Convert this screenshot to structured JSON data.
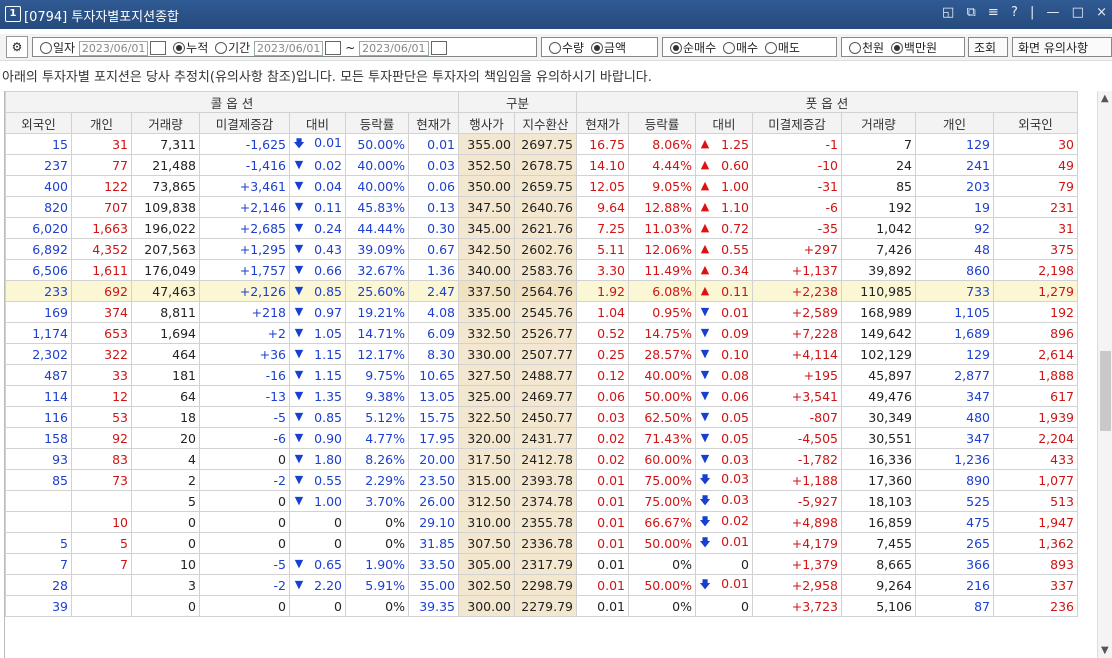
{
  "window": {
    "number": "1",
    "title": "[0794] 투자자별포지션종합",
    "controls": [
      "◱",
      "⧉",
      "≡",
      "?",
      "|",
      "—",
      "□",
      "×"
    ]
  },
  "toolbar": {
    "gear_icon": "gear-icon",
    "date_mode": [
      {
        "label": "일자",
        "selected": false
      },
      {
        "label": "누적",
        "selected": true
      },
      {
        "label": "기간",
        "selected": false
      }
    ],
    "date1": "2023/06/01",
    "date2": "2023/06/01",
    "tilde": "~",
    "date3": "2023/06/01",
    "qty_amount": [
      {
        "label": "수량",
        "selected": false
      },
      {
        "label": "금액",
        "selected": true
      }
    ],
    "buy_sell": [
      {
        "label": "순매수",
        "selected": true
      },
      {
        "label": "매수",
        "selected": false
      },
      {
        "label": "매도",
        "selected": false
      }
    ],
    "unit": [
      {
        "label": "천원",
        "selected": false
      },
      {
        "label": "백만원",
        "selected": true
      }
    ],
    "query_button": "조회",
    "notes_button": "화면 유의사항"
  },
  "notice": "아래의 투자자별 포지션은 당사 추정치(유의사항 참조)입니다. 모든 투자판단은 투자자의 책임임을 유의하시기 바랍니다.",
  "table": {
    "group_headers": {
      "call": "콜 옵 션",
      "mid": "구분",
      "put": "풋 옵 션"
    },
    "columns": [
      "외국인",
      "개인",
      "거래량",
      "미결제증감",
      "대비",
      "등락률",
      "현재가",
      "행사가",
      "지수환산",
      "현재가",
      "등락률",
      "대비",
      "미결제증감",
      "거래량",
      "개인",
      "외국인"
    ],
    "rows": [
      {
        "c_frn": "15",
        "c_ind": "31",
        "c_vol": "7,311",
        "c_oi": "-1,625",
        "c_dir": "down2",
        "c_chg": "0.01",
        "c_rate": "50.00%",
        "c_price": "0.01",
        "strike": "355.00",
        "idx": "2697.75",
        "p_price": "16.75",
        "p_rate": "8.06%",
        "p_dir": "up",
        "p_chg": "1.25",
        "p_oi": "-1",
        "p_vol": "7",
        "p_ind": "129",
        "p_frn": "30"
      },
      {
        "c_frn": "237",
        "c_ind": "77",
        "c_vol": "21,488",
        "c_oi": "-1,416",
        "c_dir": "down",
        "c_chg": "0.02",
        "c_rate": "40.00%",
        "c_price": "0.03",
        "strike": "352.50",
        "idx": "2678.75",
        "p_price": "14.10",
        "p_rate": "4.44%",
        "p_dir": "up",
        "p_chg": "0.60",
        "p_oi": "-10",
        "p_vol": "24",
        "p_ind": "241",
        "p_frn": "49"
      },
      {
        "c_frn": "400",
        "c_ind": "122",
        "c_vol": "73,865",
        "c_oi": "+3,461",
        "c_dir": "down",
        "c_chg": "0.04",
        "c_rate": "40.00%",
        "c_price": "0.06",
        "strike": "350.00",
        "idx": "2659.75",
        "p_price": "12.05",
        "p_rate": "9.05%",
        "p_dir": "up",
        "p_chg": "1.00",
        "p_oi": "-31",
        "p_vol": "85",
        "p_ind": "203",
        "p_frn": "79"
      },
      {
        "c_frn": "820",
        "c_ind": "707",
        "c_vol": "109,838",
        "c_oi": "+2,146",
        "c_dir": "down",
        "c_chg": "0.11",
        "c_rate": "45.83%",
        "c_price": "0.13",
        "strike": "347.50",
        "idx": "2640.76",
        "p_price": "9.64",
        "p_rate": "12.88%",
        "p_dir": "up",
        "p_chg": "1.10",
        "p_oi": "-6",
        "p_vol": "192",
        "p_ind": "19",
        "p_frn": "231"
      },
      {
        "c_frn": "6,020",
        "c_ind": "1,663",
        "c_vol": "196,022",
        "c_oi": "+2,685",
        "c_dir": "down",
        "c_chg": "0.24",
        "c_rate": "44.44%",
        "c_price": "0.30",
        "strike": "345.00",
        "idx": "2621.76",
        "p_price": "7.25",
        "p_rate": "11.03%",
        "p_dir": "up",
        "p_chg": "0.72",
        "p_oi": "-35",
        "p_vol": "1,042",
        "p_ind": "92",
        "p_frn": "31"
      },
      {
        "c_frn": "6,892",
        "c_ind": "4,352",
        "c_vol": "207,563",
        "c_oi": "+1,295",
        "c_dir": "down",
        "c_chg": "0.43",
        "c_rate": "39.09%",
        "c_price": "0.67",
        "strike": "342.50",
        "idx": "2602.76",
        "p_price": "5.11",
        "p_rate": "12.06%",
        "p_dir": "up",
        "p_chg": "0.55",
        "p_oi": "+297",
        "p_vol": "7,426",
        "p_ind": "48",
        "p_frn": "375"
      },
      {
        "c_frn": "6,506",
        "c_ind": "1,611",
        "c_vol": "176,049",
        "c_oi": "+1,757",
        "c_dir": "down",
        "c_chg": "0.66",
        "c_rate": "32.67%",
        "c_price": "1.36",
        "strike": "340.00",
        "idx": "2583.76",
        "p_price": "3.30",
        "p_rate": "11.49%",
        "p_dir": "up",
        "p_chg": "0.34",
        "p_oi": "+1,137",
        "p_vol": "39,892",
        "p_ind": "860",
        "p_frn": "2,198"
      },
      {
        "c_frn": "233",
        "c_ind": "692",
        "c_vol": "47,463",
        "c_oi": "+2,126",
        "c_dir": "down",
        "c_chg": "0.85",
        "c_rate": "25.60%",
        "c_price": "2.47",
        "strike": "337.50",
        "idx": "2564.76",
        "p_price": "1.92",
        "p_rate": "6.08%",
        "p_dir": "up",
        "p_chg": "0.11",
        "p_oi": "+2,238",
        "p_vol": "110,985",
        "p_ind": "733",
        "p_frn": "1,279",
        "hl": true
      },
      {
        "c_frn": "169",
        "c_ind": "374",
        "c_vol": "8,811",
        "c_oi": "+218",
        "c_dir": "down",
        "c_chg": "0.97",
        "c_rate": "19.21%",
        "c_price": "4.08",
        "strike": "335.00",
        "idx": "2545.76",
        "p_price": "1.04",
        "p_rate": "0.95%",
        "p_dir": "down",
        "p_chg": "0.01",
        "p_oi": "+2,589",
        "p_vol": "168,989",
        "p_ind": "1,105",
        "p_frn": "192"
      },
      {
        "c_frn": "1,174",
        "c_ind": "653",
        "c_vol": "1,694",
        "c_oi": "+2",
        "c_dir": "down",
        "c_chg": "1.05",
        "c_rate": "14.71%",
        "c_price": "6.09",
        "strike": "332.50",
        "idx": "2526.77",
        "p_price": "0.52",
        "p_rate": "14.75%",
        "p_dir": "down",
        "p_chg": "0.09",
        "p_oi": "+7,228",
        "p_vol": "149,642",
        "p_ind": "1,689",
        "p_frn": "896"
      },
      {
        "c_frn": "2,302",
        "c_ind": "322",
        "c_vol": "464",
        "c_oi": "+36",
        "c_dir": "down",
        "c_chg": "1.15",
        "c_rate": "12.17%",
        "c_price": "8.30",
        "strike": "330.00",
        "idx": "2507.77",
        "p_price": "0.25",
        "p_rate": "28.57%",
        "p_dir": "down",
        "p_chg": "0.10",
        "p_oi": "+4,114",
        "p_vol": "102,129",
        "p_ind": "129",
        "p_frn": "2,614"
      },
      {
        "c_frn": "487",
        "c_ind": "33",
        "c_vol": "181",
        "c_oi": "-16",
        "c_dir": "down",
        "c_chg": "1.15",
        "c_rate": "9.75%",
        "c_price": "10.65",
        "strike": "327.50",
        "idx": "2488.77",
        "p_price": "0.12",
        "p_rate": "40.00%",
        "p_dir": "down",
        "p_chg": "0.08",
        "p_oi": "+195",
        "p_vol": "45,897",
        "p_ind": "2,877",
        "p_frn": "1,888"
      },
      {
        "c_frn": "114",
        "c_ind": "12",
        "c_vol": "64",
        "c_oi": "-13",
        "c_dir": "down",
        "c_chg": "1.35",
        "c_rate": "9.38%",
        "c_price": "13.05",
        "strike": "325.00",
        "idx": "2469.77",
        "p_price": "0.06",
        "p_rate": "50.00%",
        "p_dir": "down",
        "p_chg": "0.06",
        "p_oi": "+3,541",
        "p_vol": "49,476",
        "p_ind": "347",
        "p_frn": "617"
      },
      {
        "c_frn": "116",
        "c_ind": "53",
        "c_vol": "18",
        "c_oi": "-5",
        "c_dir": "down",
        "c_chg": "0.85",
        "c_rate": "5.12%",
        "c_price": "15.75",
        "strike": "322.50",
        "idx": "2450.77",
        "p_price": "0.03",
        "p_rate": "62.50%",
        "p_dir": "down",
        "p_chg": "0.05",
        "p_oi": "-807",
        "p_vol": "30,349",
        "p_ind": "480",
        "p_frn": "1,939"
      },
      {
        "c_frn": "158",
        "c_ind": "92",
        "c_vol": "20",
        "c_oi": "-6",
        "c_dir": "down",
        "c_chg": "0.90",
        "c_rate": "4.77%",
        "c_price": "17.95",
        "strike": "320.00",
        "idx": "2431.77",
        "p_price": "0.02",
        "p_rate": "71.43%",
        "p_dir": "down",
        "p_chg": "0.05",
        "p_oi": "-4,505",
        "p_vol": "30,551",
        "p_ind": "347",
        "p_frn": "2,204"
      },
      {
        "c_frn": "93",
        "c_ind": "83",
        "c_vol": "4",
        "c_oi": "0",
        "c_dir": "down",
        "c_chg": "1.80",
        "c_rate": "8.26%",
        "c_price": "20.00",
        "strike": "317.50",
        "idx": "2412.78",
        "p_price": "0.02",
        "p_rate": "60.00%",
        "p_dir": "down",
        "p_chg": "0.03",
        "p_oi": "-1,782",
        "p_vol": "16,336",
        "p_ind": "1,236",
        "p_frn": "433"
      },
      {
        "c_frn": "85",
        "c_ind": "73",
        "c_vol": "2",
        "c_oi": "-2",
        "c_dir": "down",
        "c_chg": "0.55",
        "c_rate": "2.29%",
        "c_price": "23.50",
        "strike": "315.00",
        "idx": "2393.78",
        "p_price": "0.01",
        "p_rate": "75.00%",
        "p_dir": "down2",
        "p_chg": "0.03",
        "p_oi": "+1,188",
        "p_vol": "17,360",
        "p_ind": "890",
        "p_frn": "1,077"
      },
      {
        "c_frn": "",
        "c_ind": "",
        "c_vol": "5",
        "c_oi": "0",
        "c_dir": "down",
        "c_chg": "1.00",
        "c_rate": "3.70%",
        "c_price": "26.00",
        "strike": "312.50",
        "idx": "2374.78",
        "p_price": "0.01",
        "p_rate": "75.00%",
        "p_dir": "down2",
        "p_chg": "0.03",
        "p_oi": "-5,927",
        "p_vol": "18,103",
        "p_ind": "525",
        "p_frn": "513"
      },
      {
        "c_frn": "",
        "c_ind": "10",
        "c_vol": "0",
        "c_oi": "0",
        "c_dir": "",
        "c_chg": "0",
        "c_rate": "0%",
        "c_price": "29.10",
        "strike": "310.00",
        "idx": "2355.78",
        "p_price": "0.01",
        "p_rate": "66.67%",
        "p_dir": "down2",
        "p_chg": "0.02",
        "p_oi": "+4,898",
        "p_vol": "16,859",
        "p_ind": "475",
        "p_frn": "1,947"
      },
      {
        "c_frn": "5",
        "c_ind": "5",
        "c_vol": "0",
        "c_oi": "0",
        "c_dir": "",
        "c_chg": "0",
        "c_rate": "0%",
        "c_price": "31.85",
        "strike": "307.50",
        "idx": "2336.78",
        "p_price": "0.01",
        "p_rate": "50.00%",
        "p_dir": "down2",
        "p_chg": "0.01",
        "p_oi": "+4,179",
        "p_vol": "7,455",
        "p_ind": "265",
        "p_frn": "1,362"
      },
      {
        "c_frn": "7",
        "c_ind": "7",
        "c_vol": "10",
        "c_oi": "-5",
        "c_dir": "down",
        "c_chg": "0.65",
        "c_rate": "1.90%",
        "c_price": "33.50",
        "strike": "305.00",
        "idx": "2317.79",
        "p_price": "0.01",
        "p_rate": "0%",
        "p_dir": "",
        "p_chg": "0",
        "p_oi": "+1,379",
        "p_vol": "8,665",
        "p_ind": "366",
        "p_frn": "893"
      },
      {
        "c_frn": "28",
        "c_ind": "",
        "c_vol": "3",
        "c_oi": "-2",
        "c_dir": "down",
        "c_chg": "2.20",
        "c_rate": "5.91%",
        "c_price": "35.00",
        "strike": "302.50",
        "idx": "2298.79",
        "p_price": "0.01",
        "p_rate": "50.00%",
        "p_dir": "down2",
        "p_chg": "0.01",
        "p_oi": "+2,958",
        "p_vol": "9,264",
        "p_ind": "216",
        "p_frn": "337"
      },
      {
        "c_frn": "39",
        "c_ind": "",
        "c_vol": "0",
        "c_oi": "0",
        "c_dir": "",
        "c_chg": "0",
        "c_rate": "0%",
        "c_price": "39.35",
        "strike": "300.00",
        "idx": "2279.79",
        "p_price": "0.01",
        "p_rate": "0%",
        "p_dir": "",
        "p_chg": "0",
        "p_oi": "+3,723",
        "p_vol": "5,106",
        "p_ind": "87",
        "p_frn": "236"
      }
    ]
  },
  "colors": {
    "up": "#e01010",
    "down": "#1840d0",
    "mid_bg": "#f3e7cf",
    "highlight_bg": "#fbf6d4",
    "title_bg": "#2f5a93"
  }
}
